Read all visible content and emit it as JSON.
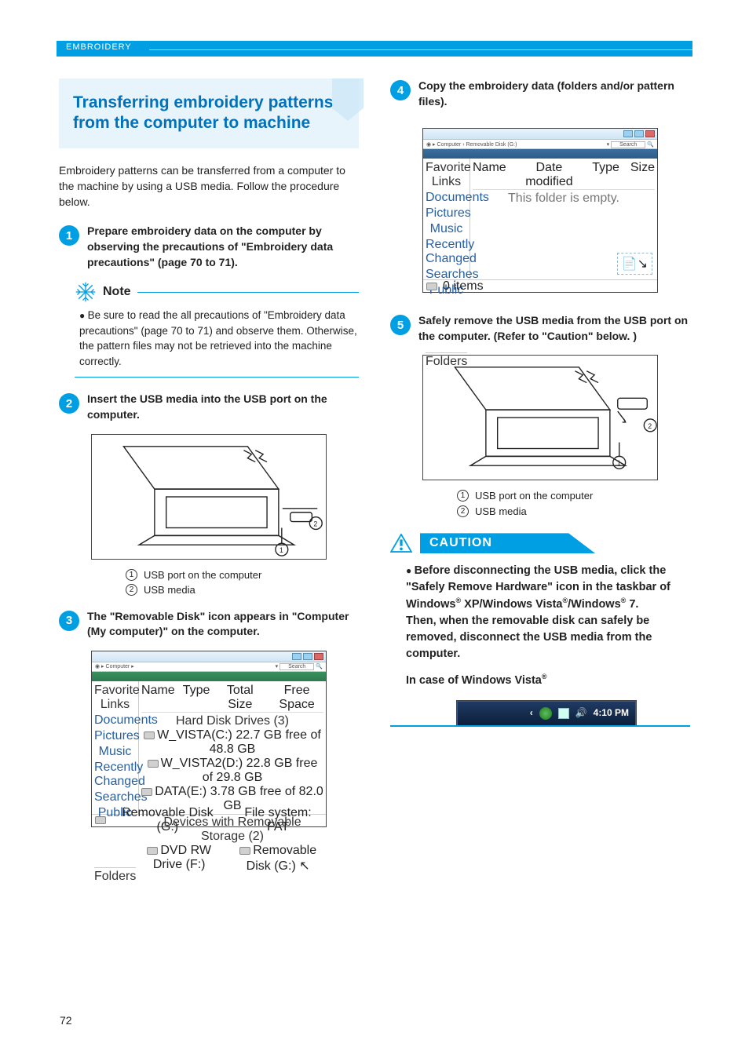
{
  "header": {
    "section": "EMBROIDERY"
  },
  "title": "Transferring embroidery patterns from the computer to machine",
  "intro": "Embroidery patterns can be transferred from a computer to the machine by using a USB media. Follow the procedure below.",
  "steps": {
    "s1": {
      "num": "1",
      "text": "Prepare embroidery data on the computer by observing the precautions of \"Embroidery data precautions\" (page 70 to 71)."
    },
    "s2": {
      "num": "2",
      "text": "Insert the USB media into the USB port on the computer."
    },
    "s3": {
      "num": "3",
      "text": "The \"Removable Disk\" icon appears in \"Computer (My computer)\" on the computer."
    },
    "s4": {
      "num": "4",
      "text": "Copy the embroidery data (folders and/or pattern files)."
    },
    "s5": {
      "num": "5",
      "text": "Safely remove the USB media from the USB port on the computer. (Refer to \"Caution\" below. )"
    }
  },
  "note": {
    "title": "Note",
    "body": "Be sure to read the all precautions of \"Embroidery data precautions\" (page 70 to 71) and observe them. Otherwise, the pattern files may not be retrieved into the machine correctly."
  },
  "callouts": {
    "c1": "USB port on the computer",
    "c2": "USB media"
  },
  "caution": {
    "title": "CAUTION",
    "p1a": "Before disconnecting the USB media, click the \"Safely Remove Hardware\" icon in the taskbar of Windows",
    "p1b": " XP/Windows Vista",
    "p1c": "/Windows",
    "p1d": " 7.",
    "p2": "Then, when the removable disk can safely be removed, disconnect the USB media from the computer.",
    "p3a": "In case of Windows Vista",
    "reg": "®"
  },
  "explorer1": {
    "breadcrumb": "Computer",
    "sidebar_title": "Favorite Links",
    "sidebar": [
      "Documents",
      "Pictures",
      "Music",
      "Recently Changed",
      "Searches",
      "Public"
    ],
    "group1": "Hard Disk Drives (3)",
    "drives": [
      "W_VISTA(C:)  22.7 GB free of 48.8 GB",
      "W_VISTA2(D:)  22.8 GB free of 29.8 GB",
      "DATA(E:)  3.78 GB free of 82.0 GB"
    ],
    "group2": "Devices with Removable Storage (2)",
    "devices": [
      "DVD RW Drive (F:)",
      "Removable Disk (G:)"
    ],
    "folders": "Folders",
    "status1": "Removable Disk (G:)",
    "status2": "File system: FAT",
    "cols": [
      "Name",
      "Type",
      "Total Size",
      "Free Space"
    ],
    "search": "Search"
  },
  "explorer2": {
    "breadcrumb": "Computer › Removable Disk (G:)",
    "sidebar_title": "Favorite Links",
    "sidebar": [
      "Documents",
      "Pictures",
      "Music",
      "Recently Changed",
      "Searches",
      "Public"
    ],
    "cols": [
      "Name",
      "Date modified",
      "Type",
      "Size"
    ],
    "empty": "This folder is empty.",
    "folders": "Folders",
    "status": "0 items",
    "search": "Search"
  },
  "taskbar": {
    "time": "4:10 PM"
  },
  "page": "72"
}
